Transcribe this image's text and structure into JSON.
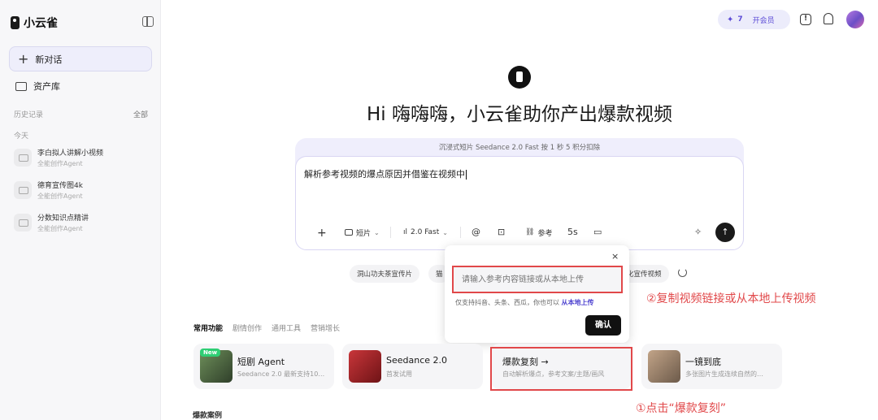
{
  "sidebar": {
    "brand": "小云雀",
    "new_chat": "新对话",
    "asset_library": "资产库",
    "history_label": "历史记录",
    "history_all": "全部",
    "today_label": "今天",
    "items": [
      {
        "title": "李白拟人讲解小视频",
        "sub": "全能创作Agent"
      },
      {
        "title": "德育宣传图4k",
        "sub": "全能创作Agent"
      },
      {
        "title": "分数知识点精讲",
        "sub": "全能创作Agent"
      }
    ]
  },
  "header": {
    "credits": "7",
    "vip_label": "开会员"
  },
  "hero": {
    "title": "Hi 嗨嗨嗨，小云雀助你产出爆款视频"
  },
  "composer": {
    "note": "沉浸式短片 Seedance 2.0 Fast 按 1 秒 5 积分扣除",
    "text": "解析参考视频的爆点原因并借鉴在视频中",
    "mode": "短片",
    "model": "2.0 Fast",
    "reference_label": "参考",
    "duration": "5s"
  },
  "suggestions": [
    "洞山功夫茶宣传片",
    "猫",
    "化宣传视频"
  ],
  "popup": {
    "close": "×",
    "input_placeholder": "请输入参考内容链接或从本地上传",
    "hint_prefix": "仅支持抖音、头条、西瓜，你也可以",
    "hint_link": "从本地上传",
    "confirm": "确认"
  },
  "tabs": [
    "常用功能",
    "剧情创作",
    "通用工具",
    "营销增长"
  ],
  "cards": [
    {
      "title": "短剧 Agent",
      "desc": "Seedance 2.0 最新支持10…",
      "badge": "New"
    },
    {
      "title": "Seedance 2.0",
      "desc": "首发试用"
    },
    {
      "title": "爆款复刻 →",
      "desc": "自动解析爆点，参考文案/主题/画风"
    },
    {
      "title": "一镜到底",
      "desc": "多张图片生成连续自然的…"
    }
  ],
  "annotations": {
    "step1": "①点击“爆款复刻”",
    "step2": "②复制视频链接或从本地上传视频"
  },
  "cases_label": "爆款案例",
  "colors": {
    "accent": "#5b4bd6",
    "annotation": "#e1484a"
  }
}
